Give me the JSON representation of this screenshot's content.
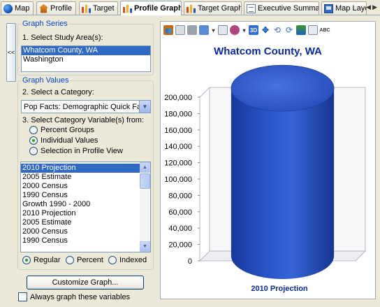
{
  "tabs": [
    {
      "label": "Map",
      "icon": "globe-icon",
      "active": false
    },
    {
      "label": "Profile",
      "icon": "house-icon",
      "active": false
    },
    {
      "label": "Target",
      "icon": "bar-chart-icon",
      "active": false
    },
    {
      "label": "Profile Graph",
      "icon": "bar-chart-icon",
      "active": true
    },
    {
      "label": "Target Graph",
      "icon": "bar-chart-icon",
      "active": false
    },
    {
      "label": "Executive Summary",
      "icon": "document-icon",
      "active": false
    },
    {
      "label": "Map Layo",
      "icon": "map-layout-icon",
      "active": false
    }
  ],
  "left_panel": {
    "collapse_label": "<<",
    "graph_series": {
      "legend": "Graph Series",
      "step1": "1.  Select Study Area(s):",
      "areas": [
        "Whatcom County, WA",
        "Washington"
      ],
      "selected_area": "Whatcom County, WA"
    },
    "graph_values": {
      "legend": "Graph Values",
      "step2": "2.  Select a Category:",
      "category": "Pop Facts:  Demographic Quick Facts",
      "step3": "3.  Select Category Variable(s) from:",
      "sources": [
        "Percent Groups",
        "Individual Values",
        "Selection in Profile View"
      ],
      "selected_source": "Individual Values",
      "variables": [
        "2010 Projection",
        "2005 Estimate",
        "2000 Census",
        "1990 Census",
        "Growth 1990 - 2000",
        "2010 Projection",
        "2005 Estimate",
        "2000 Census",
        "1990 Census"
      ],
      "selected_variable": "2010 Projection",
      "scales": [
        "Regular",
        "Percent",
        "Indexed"
      ],
      "selected_scale": "Regular"
    },
    "customize_button": "Customize Graph...",
    "always_graph_label": "Always graph these variables",
    "always_graph_checked": false
  },
  "chart_panel": {
    "toolbar_icons": [
      "people-icon",
      "copy-icon",
      "print-icon",
      "chart-type-icon",
      "dropdown-arrow-icon",
      "legend-icon",
      "palette-icon",
      "dropdown-arrow-icon",
      "3d-icon",
      "move-icon",
      "rotate-left-icon",
      "rotate-right-icon",
      "color-icon",
      "data-table-icon",
      "abc-labels-icon"
    ],
    "colors": {
      "bar": "#2a55c9",
      "bar_dark": "#163a9e",
      "title": "#0a2a9c"
    }
  },
  "chart_data": {
    "type": "bar",
    "title": "Whatcom County, WA",
    "categories": [
      "2010 Projection"
    ],
    "values": [
      205000
    ],
    "ylim": [
      0,
      200000
    ],
    "yticks": [
      0,
      20000,
      40000,
      60000,
      80000,
      100000,
      120000,
      140000,
      160000,
      180000,
      200000
    ],
    "ytick_labels": [
      "0",
      "20,000",
      "40,000",
      "60,000",
      "80,000",
      "100,000",
      "120,000",
      "140,000",
      "160,000",
      "180,000",
      "200,000"
    ],
    "grid": false,
    "style": "3d-cylinder"
  }
}
